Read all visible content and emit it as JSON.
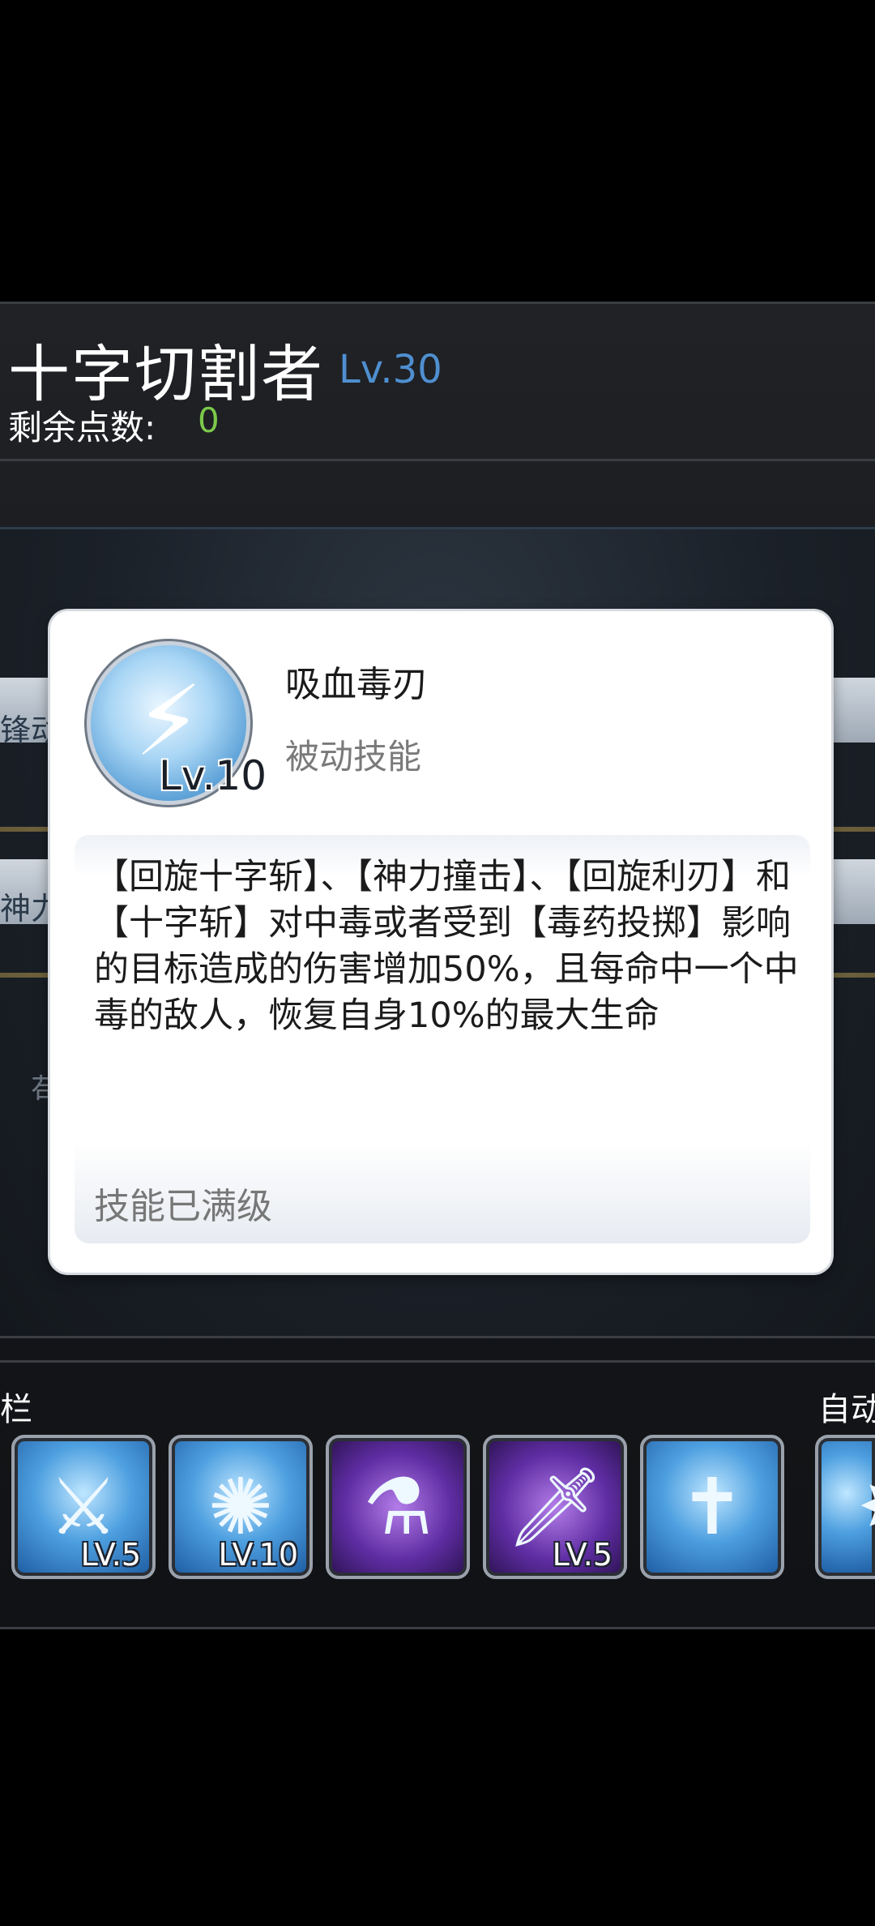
{
  "header": {
    "class_name": "十字切割者",
    "level": "Lv.30",
    "points_label": "剩余点数:",
    "points_value": "0"
  },
  "background": {
    "partial_text_1": "锋动",
    "partial_text_2": "神力",
    "partial_text_3": "苟"
  },
  "skill_bar": {
    "label": "栏",
    "auto_label": "自动",
    "slots": [
      {
        "icon": "blade-strike-icon",
        "level": "LV.5",
        "color": "#4ea0e0"
      },
      {
        "icon": "ground-burst-icon",
        "level": "LV.10",
        "color": "#4ea0e0"
      },
      {
        "icon": "poison-flask-icon",
        "level": "",
        "color": "#5f2da3"
      },
      {
        "icon": "poison-dagger-icon",
        "level": "LV.5",
        "color": "#5f2da3"
      },
      {
        "icon": "sword-spin-icon",
        "level": "",
        "color": "#4ea0e0"
      },
      {
        "icon": "star-slash-icon",
        "level": "",
        "color": "#4ea0e0"
      }
    ]
  },
  "popup": {
    "skill_icon": "vampire-blade-icon",
    "icon_level": "Lv.10",
    "skill_name": "吸血毒刃",
    "skill_type": "被动技能",
    "description": "【回旋十字斩】、【神力撞击】、【回旋利刃】和【十字斩】对中毒或者受到【毒药投掷】影响的目标造成的伤害增加50%，且每命中一个中毒的敌人，恢复自身10%的最大生命",
    "max_level_text": "技能已满级"
  }
}
